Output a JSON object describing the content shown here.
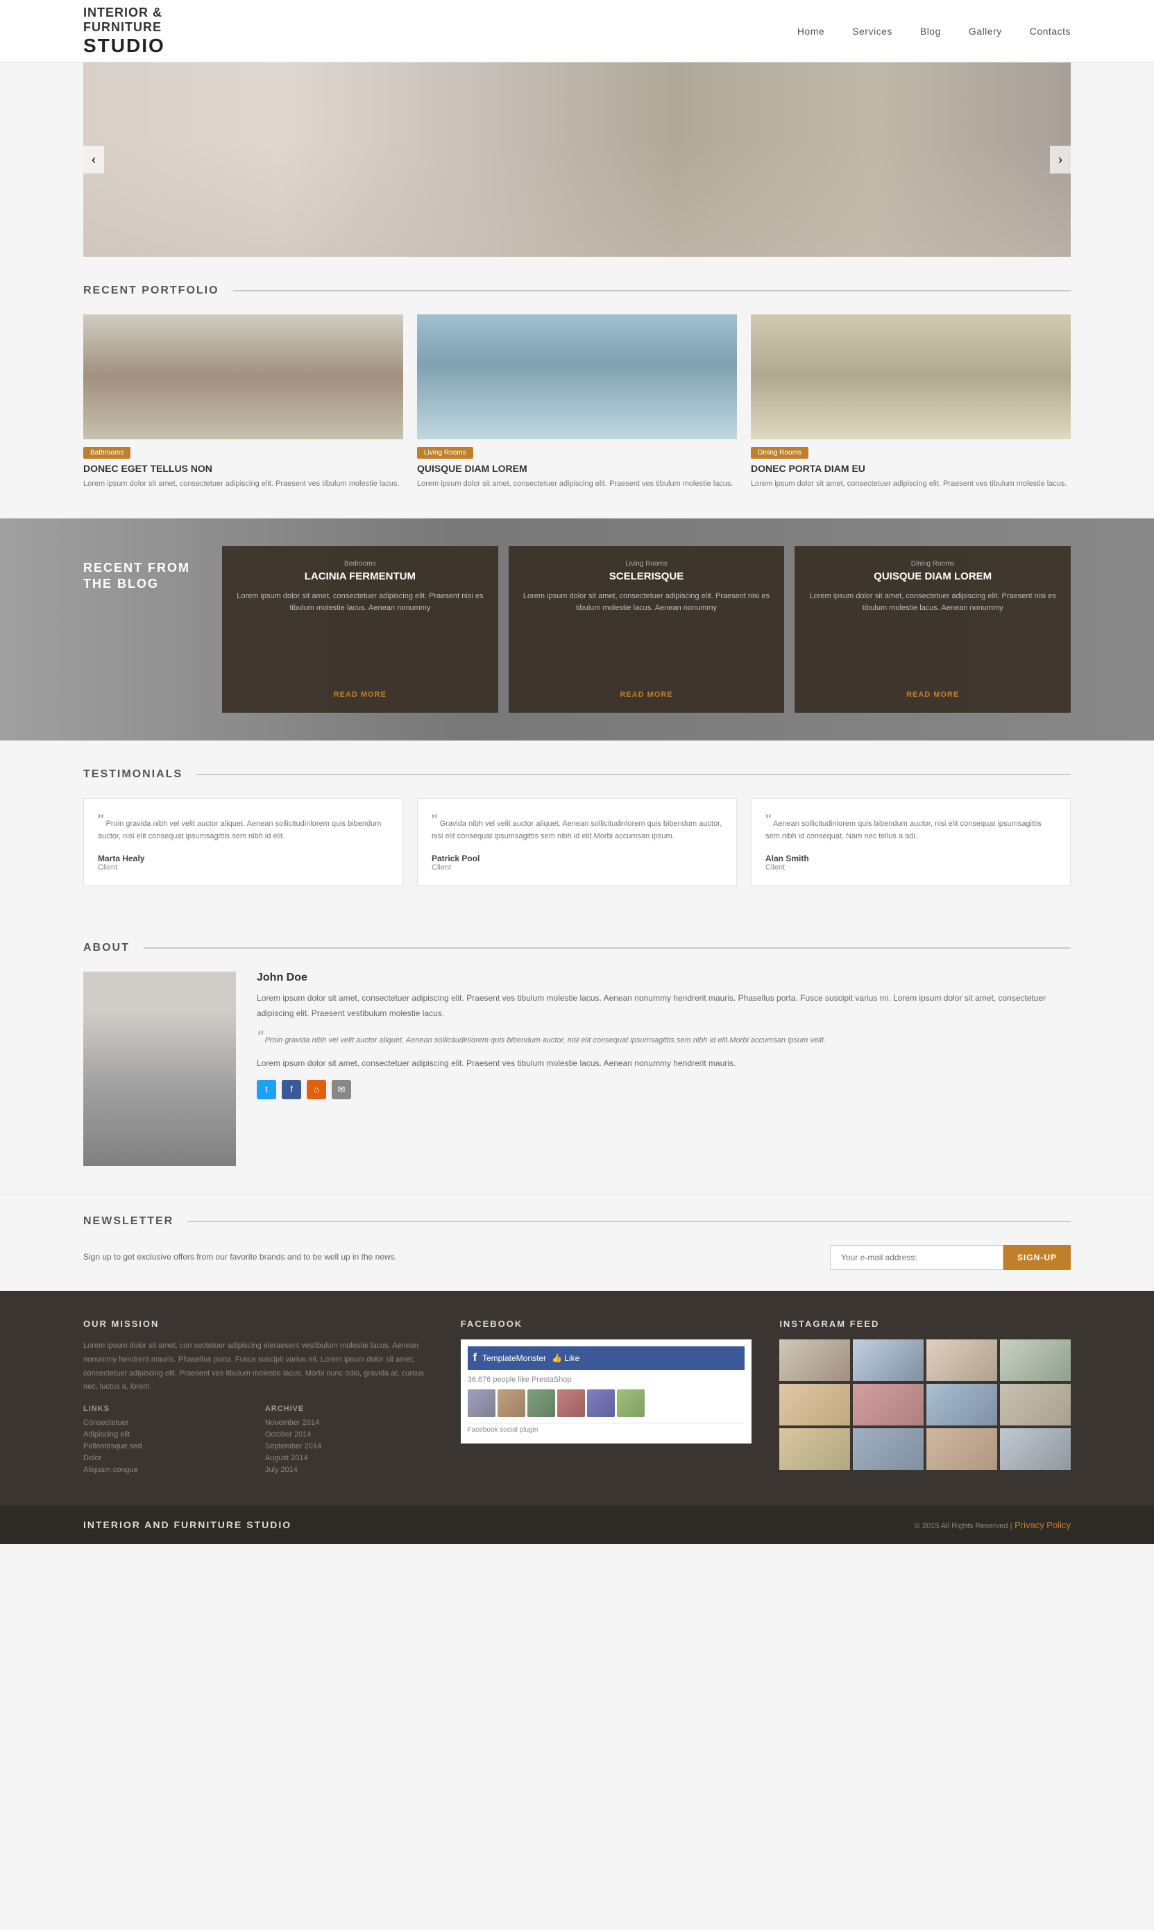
{
  "header": {
    "logo_line1": "INTERIOR &",
    "logo_line2": "FURNITURE",
    "logo_studio": "STUDIO",
    "nav": [
      {
        "label": "Home",
        "id": "nav-home"
      },
      {
        "label": "Services",
        "id": "nav-services"
      },
      {
        "label": "Blog",
        "id": "nav-blog"
      },
      {
        "label": "Gallery",
        "id": "nav-gallery"
      },
      {
        "label": "Contacts",
        "id": "nav-contacts"
      }
    ]
  },
  "hero": {
    "prev_arrow": "‹",
    "next_arrow": "›"
  },
  "portfolio": {
    "section_title": "RECENT PORTFOLIO",
    "items": [
      {
        "badge": "Bathrooms",
        "badge_class": "badge-bathroom",
        "title": "DONEC EGET TELLUS NON",
        "text": "Lorem ipsum dolor sit amet, consectetuer adipiscing elit. Praesent ves tibulum molestie lacus."
      },
      {
        "badge": "Living Rooms",
        "badge_class": "badge-living",
        "title": "QUISQUE DIAM LOREM",
        "text": "Lorem ipsum dolor sit amet, consectetuer adipiscing elit. Praesent ves tibulum molestie lacus."
      },
      {
        "badge": "Dining Rooms",
        "badge_class": "badge-dining",
        "title": "DONEC PORTA DIAM EU",
        "text": "Lorem ipsum dolor sit amet, consectetuer adipiscing elit. Praesent ves tibulum molestie lacus."
      }
    ]
  },
  "blog": {
    "section_label_1": "RECENT FROM",
    "section_label_2": "THE BLOG",
    "cards": [
      {
        "category": "Bedrooms",
        "title": "LACINIA FERMENTUM",
        "text": "Lorem ipsum dolor sit amet, consectetuer adipiscing elit. Praesent nisi es tibulum molestie lacus. Aenean nonummy",
        "read_more": "READ MORE"
      },
      {
        "category": "Living Rooms",
        "title": "SCELERISQUE",
        "text": "Lorem ipsum dolor sit amet, consectetuer adipiscing elit. Praesent nisi es tibulum molestie lacus. Aenean nonummy",
        "read_more": "READ MORE"
      },
      {
        "category": "Dining Rooms",
        "title": "QUISQUE DIAM LOREM",
        "text": "Lorem ipsum dolor sit amet, consectetuer adipiscing elit. Praesent nisi es tibulum molestie lacus. Aenean nonummy",
        "read_more": "READ MORE"
      }
    ]
  },
  "testimonials": {
    "section_title": "TESTIMONIALS",
    "items": [
      {
        "quote": "Proin gravida nibh vel velit auctor aliquet. Aenean sollicitudinlorem quis bibendum auctor, nisi elit consequat ipsumsagittis sem nibh id elit.",
        "author": "Marta Healy",
        "role": "Client"
      },
      {
        "quote": "Gravida nibh vel velit auctor aliquet. Aenean sollicitudinlorem quis bibendum auctor, nisi elit consequat ipsumsagittis sem nibh id elit.Morbi accumsan ipsum.",
        "author": "Patrick Pool",
        "role": "Client"
      },
      {
        "quote": "Aenean sollicitudinlorem quis bibendum auctor, nisi elit consequat ipsumsagittis sem nibh id consequat. Nam nec tellus a adi.",
        "author": "Alan Smith",
        "role": "Client"
      }
    ]
  },
  "about": {
    "section_title": "ABOUT",
    "name": "John Doe",
    "para1": "Lorem ipsum dolor sit amet, consectetuer adipiscing elit. Praesent ves tibulum molestie lacus. Aenean nonummy hendrerit mauris. Phasellus porta. Fusce suscipit varius mi. Lorem ipsum dolor sit amet, consectetuer adipiscing elit. Praesent vestibulum molestie lacus.",
    "quote": "Proin gravida nibh vel velit auctor aliquet. Aenean sollicitudinlorem quis bibendum auctor, nisi elit consequat ipsumsagittis sem nibh id elit.Morbi accumsan ipsum velit.",
    "para2": "Lorem ipsum dolor sit amet, consectetuer adipiscing elit. Praesent ves tibulum molestie lacus. Aenean nonummy hendrerit mauris.",
    "icons": [
      {
        "name": "twitter-icon",
        "symbol": "t",
        "class": "icon-twitter"
      },
      {
        "name": "facebook-icon",
        "symbol": "f",
        "class": "icon-facebook"
      },
      {
        "name": "rss-icon",
        "symbol": "⌂",
        "class": "icon-rss"
      },
      {
        "name": "mail-icon",
        "symbol": "✉",
        "class": "icon-mail"
      }
    ]
  },
  "newsletter": {
    "section_title": "NEWSLETTER",
    "description": "Sign up to get exclusive offers from our favorite brands and to be well up in the news.",
    "input_placeholder": "Your e-mail address:",
    "button_label": "SIGN-UP"
  },
  "footer": {
    "mission_heading": "OUR MISSION",
    "mission_text": "Lorem ipsum dolor sit amet, con sectetuer adipiscing eleraesent vestibulum molestie lacus. Aenean nonummy hendrerit mauris. Phasellus porta. Fusce suscipit varius mi. Lorem ipsum dolor sit amet, consectetuer adipiscing elit. Praesent ves tibulum molestie lacus. Morbi nunc odio, gravida at, cursus nec, luctus a, lorem.",
    "links_heading": "LINKS",
    "links": [
      "Consectetuer",
      "Adipiscing elit",
      "Pellentesque sed",
      "Dolor",
      "Aliquam congue"
    ],
    "archive_heading": "ARCHIVE",
    "archive": [
      "November 2014",
      "October 2014",
      "September 2014",
      "August 2014",
      "July 2014"
    ],
    "facebook_heading": "FACEBOOK",
    "facebook_count": "36,676 people like PrestaShop",
    "facebook_bottom": "Facebook social plugin",
    "instagram_heading": "INSTAGRAM FEED",
    "brand": "INTERIOR AND FURNITURE STUDIO",
    "copyright": "© 2015 All Rights Reserved  |",
    "privacy": "Privacy Policy"
  }
}
